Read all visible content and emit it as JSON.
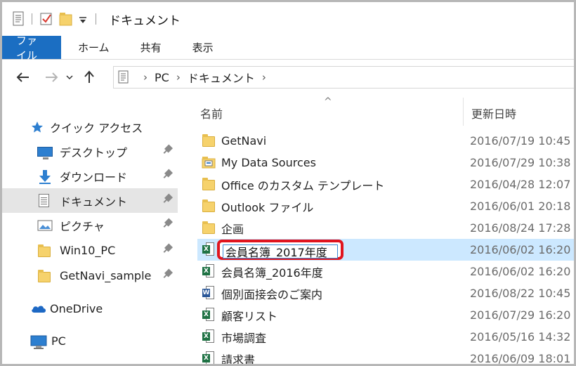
{
  "titlebar": {
    "title": "ドキュメント",
    "icons": [
      "properties-icon",
      "checkmark-icon",
      "new-folder-icon",
      "customize-dropdown-icon"
    ]
  },
  "ribbon": {
    "tabs": [
      "ファイル",
      "ホーム",
      "共有",
      "表示"
    ],
    "file_tab_color": "#1b6ec2"
  },
  "navigation": {
    "back_icon": "back-arrow-icon",
    "forward_icon": "forward-arrow-icon",
    "recent_icon": "chevron-down-icon",
    "up_icon": "up-arrow-icon",
    "breadcrumb": [
      "PC",
      "ドキュメント"
    ]
  },
  "sidebar": {
    "quick_access": "クイック アクセス",
    "items": [
      {
        "label": "デスクトップ",
        "icon": "desktop-icon",
        "pinned": true
      },
      {
        "label": "ダウンロード",
        "icon": "download-icon",
        "pinned": true
      },
      {
        "label": "ドキュメント",
        "icon": "documents-icon",
        "pinned": true,
        "selected": true
      },
      {
        "label": "ピクチャ",
        "icon": "pictures-icon",
        "pinned": true
      },
      {
        "label": "Win10_PC",
        "icon": "folder-icon",
        "pinned": true
      },
      {
        "label": "GetNavi_sample",
        "icon": "folder-icon",
        "pinned": true
      }
    ],
    "onedrive": "OneDrive",
    "pc": "PC"
  },
  "columns": {
    "name": "名前",
    "date": "更新日時",
    "sort_indicator": "^"
  },
  "files": [
    {
      "name": "GetNavi",
      "date": "2016/07/19 10:45",
      "type": "folder"
    },
    {
      "name": "My Data Sources",
      "date": "2016/07/29 10:38",
      "type": "special-folder"
    },
    {
      "name": "Office のカスタム テンプレート",
      "date": "2016/04/28 12:07",
      "type": "folder"
    },
    {
      "name": "Outlook ファイル",
      "date": "2016/06/01 20:18",
      "type": "folder"
    },
    {
      "name": "企画",
      "date": "2016/08/24 17:28",
      "type": "folder"
    },
    {
      "name": "会員名簿_2017年度",
      "date": "2016/06/02 16:20",
      "type": "excel",
      "renaming": true
    },
    {
      "name": "会員名簿_2016年度",
      "date": "2016/06/02 16:20",
      "type": "excel"
    },
    {
      "name": "個別面接会のご案内",
      "date": "2016/08/22 10:45",
      "type": "word"
    },
    {
      "name": "顧客リスト",
      "date": "2016/07/29 16:20",
      "type": "excel"
    },
    {
      "name": "市場調査",
      "date": "2016/05/16 14:32",
      "type": "excel"
    },
    {
      "name": "請求書",
      "date": "2016/06/09 18:01",
      "type": "excel"
    }
  ],
  "rename_highlight_color": "#e0141e",
  "selection_color": "#cce8ff"
}
